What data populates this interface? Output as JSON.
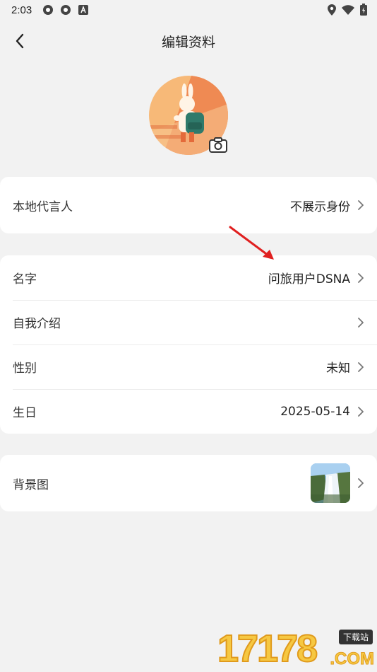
{
  "status_bar": {
    "time": "2:03"
  },
  "header": {
    "title": "编辑资料"
  },
  "avatar": {
    "camera_icon": "camera-icon"
  },
  "local_spokesperson": {
    "label": "本地代言人",
    "value": "不展示身份"
  },
  "profile": {
    "name": {
      "label": "名字",
      "value": "问旅用户DSNA"
    },
    "intro": {
      "label": "自我介绍",
      "value": ""
    },
    "gender": {
      "label": "性别",
      "value": "未知"
    },
    "birthday": {
      "label": "生日",
      "value": "2025-05-14"
    }
  },
  "background": {
    "label": "背景图"
  },
  "watermark": {
    "number": "17178",
    "badge": "下载站",
    "suffix": ".COM"
  },
  "colors": {
    "annotation_arrow": "#e02020",
    "avatar_bg": "#f7b978"
  }
}
